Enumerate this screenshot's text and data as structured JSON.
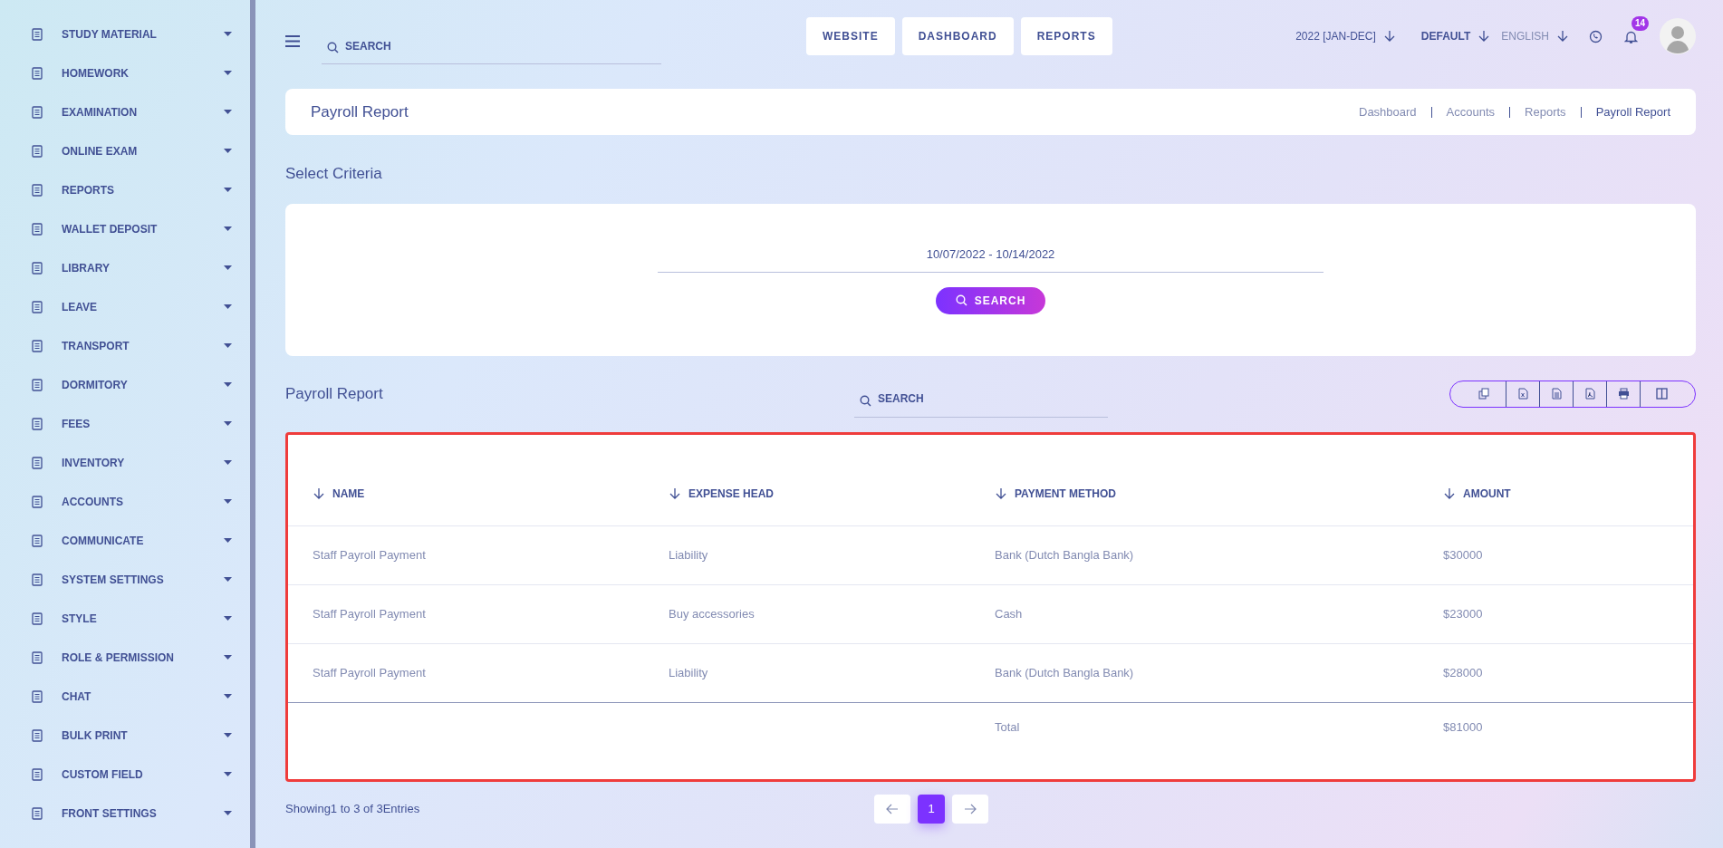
{
  "sidebar": {
    "items": [
      {
        "label": "STUDY MATERIAL"
      },
      {
        "label": "HOMEWORK"
      },
      {
        "label": "EXAMINATION"
      },
      {
        "label": "ONLINE EXAM"
      },
      {
        "label": "REPORTS"
      },
      {
        "label": "WALLET DEPOSIT"
      },
      {
        "label": "LIBRARY"
      },
      {
        "label": "LEAVE"
      },
      {
        "label": "TRANSPORT"
      },
      {
        "label": "DORMITORY"
      },
      {
        "label": "FEES"
      },
      {
        "label": "INVENTORY"
      },
      {
        "label": "ACCOUNTS"
      },
      {
        "label": "COMMUNICATE"
      },
      {
        "label": "SYSTEM SETTINGS"
      },
      {
        "label": "STYLE"
      },
      {
        "label": "ROLE & PERMISSION"
      },
      {
        "label": "CHAT"
      },
      {
        "label": "BULK PRINT"
      },
      {
        "label": "CUSTOM FIELD"
      },
      {
        "label": "FRONT SETTINGS"
      }
    ]
  },
  "topbar": {
    "search": {
      "placeholder": "SEARCH"
    },
    "nav_buttons": [
      "WEBSITE",
      "DASHBOARD",
      "REPORTS"
    ],
    "session": "2022 [JAN-DEC]",
    "school": "DEFAULT",
    "language": "ENGLISH",
    "notification_count": "14"
  },
  "header": {
    "title": "Payroll Report",
    "breadcrumb": [
      "Dashboard",
      "Accounts",
      "Reports",
      "Payroll Report"
    ]
  },
  "criteria": {
    "title": "Select Criteria",
    "date_range": "10/07/2022 - 10/14/2022",
    "search_button": "SEARCH"
  },
  "report": {
    "title": "Payroll Report",
    "search": {
      "placeholder": "SEARCH"
    },
    "export_buttons": [
      {
        "kind": "copy"
      },
      {
        "kind": "excel"
      },
      {
        "kind": "csv"
      },
      {
        "kind": "pdf"
      },
      {
        "kind": "print"
      },
      {
        "kind": "columns"
      }
    ],
    "table": {
      "columns": [
        "NAME",
        "EXPENSE HEAD",
        "PAYMENT METHOD",
        "AMOUNT"
      ],
      "rows": [
        [
          "Staff Payroll Payment",
          "Liability",
          "Bank (Dutch Bangla Bank)",
          "$30000"
        ],
        [
          "Staff Payroll Payment",
          "Buy accessories",
          "Cash",
          "$23000"
        ],
        [
          "Staff Payroll Payment",
          "Liability",
          "Bank (Dutch Bangla Bank)",
          "$28000"
        ]
      ],
      "total": {
        "label": "Total",
        "amount": "$81000"
      }
    },
    "footer": "Showing1 to 3 of 3Entries",
    "pages": [
      {
        "label": "1",
        "selected": true
      }
    ]
  }
}
